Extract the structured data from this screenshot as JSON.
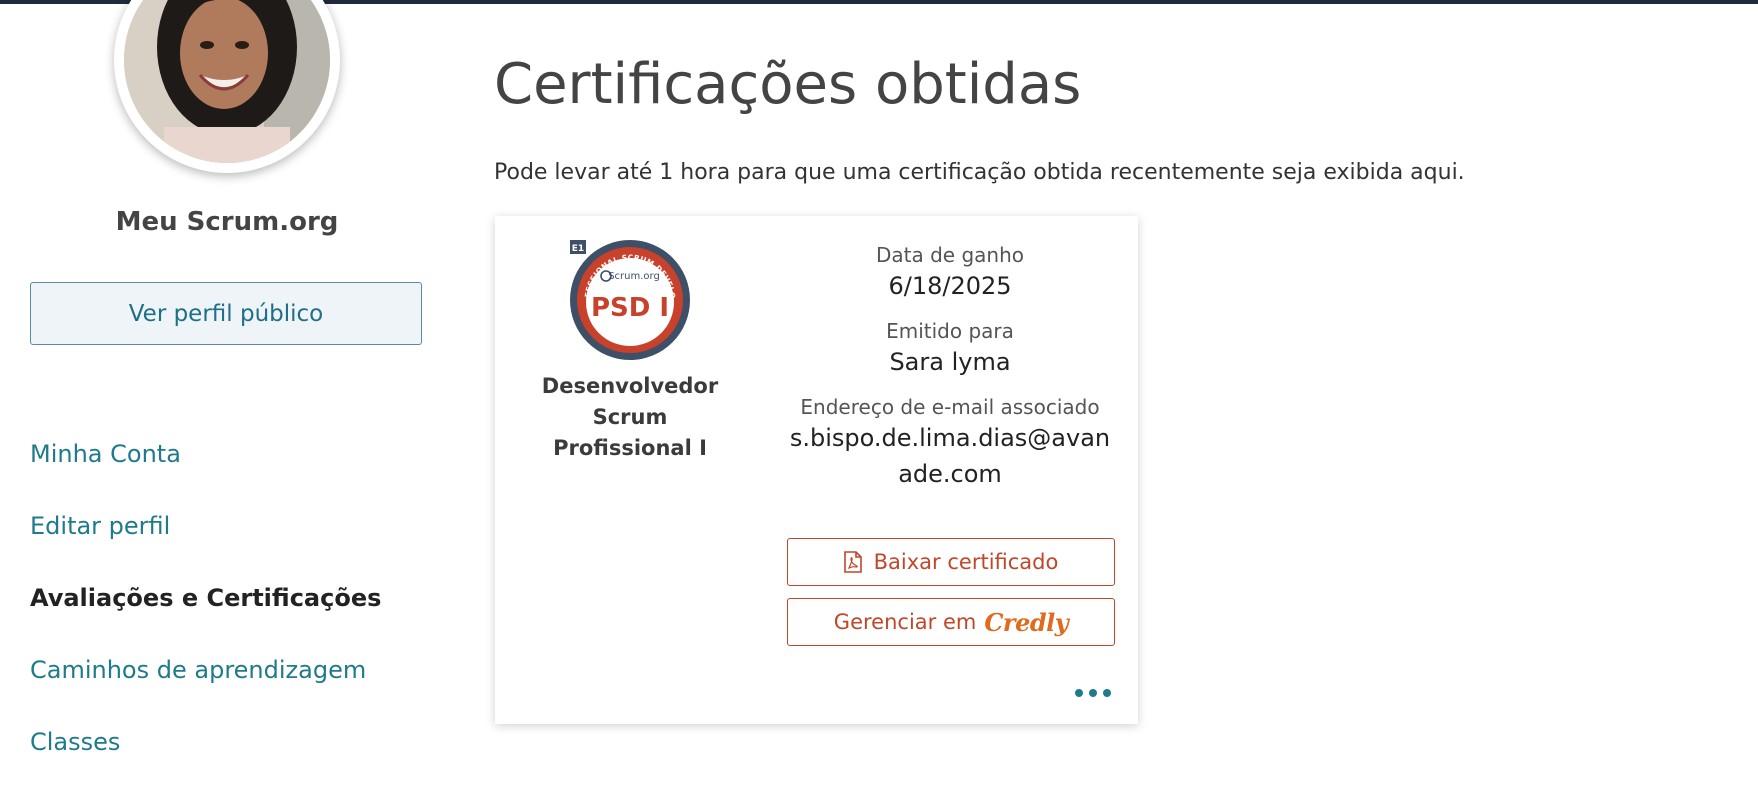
{
  "sidebar": {
    "title": "Meu Scrum.org",
    "public_profile_button": "Ver perfil público",
    "nav": [
      {
        "label": "Minha Conta",
        "active": false
      },
      {
        "label": "Editar perfil",
        "active": false
      },
      {
        "label": "Avaliações e Certificações",
        "active": true
      },
      {
        "label": "Caminhos de aprendizagem",
        "active": false
      },
      {
        "label": "Classes",
        "active": false
      }
    ]
  },
  "main": {
    "title": "Certificações obtidas",
    "note": "Pode levar até 1 hora para que uma certificação obtida recentemente seja exibida aqui."
  },
  "certificate": {
    "badge_text": "PSD I",
    "badge_brand": "Scrum.org",
    "badge_ring_text": "PROFESSIONAL SCRUM DEVELOPER",
    "badge_level": "E1",
    "name": "Desenvolvedor Scrum Profissional I",
    "earned_label": "Data de ganho",
    "earned_value": "6/18/2025",
    "issued_label": "Emitido para",
    "issued_value": "Sara lyma",
    "email_label": "Endereço de e-mail associado",
    "email_value": "s.bispo.de.lima.dias@avanade.com",
    "download_button": "Baixar certificado",
    "manage_button": "Gerenciar em",
    "manage_brand": "Credly"
  },
  "colors": {
    "accent": "#1f7a8c",
    "action": "#c0472a",
    "badge_red": "#c8412b",
    "badge_navy": "#3e4f68"
  }
}
